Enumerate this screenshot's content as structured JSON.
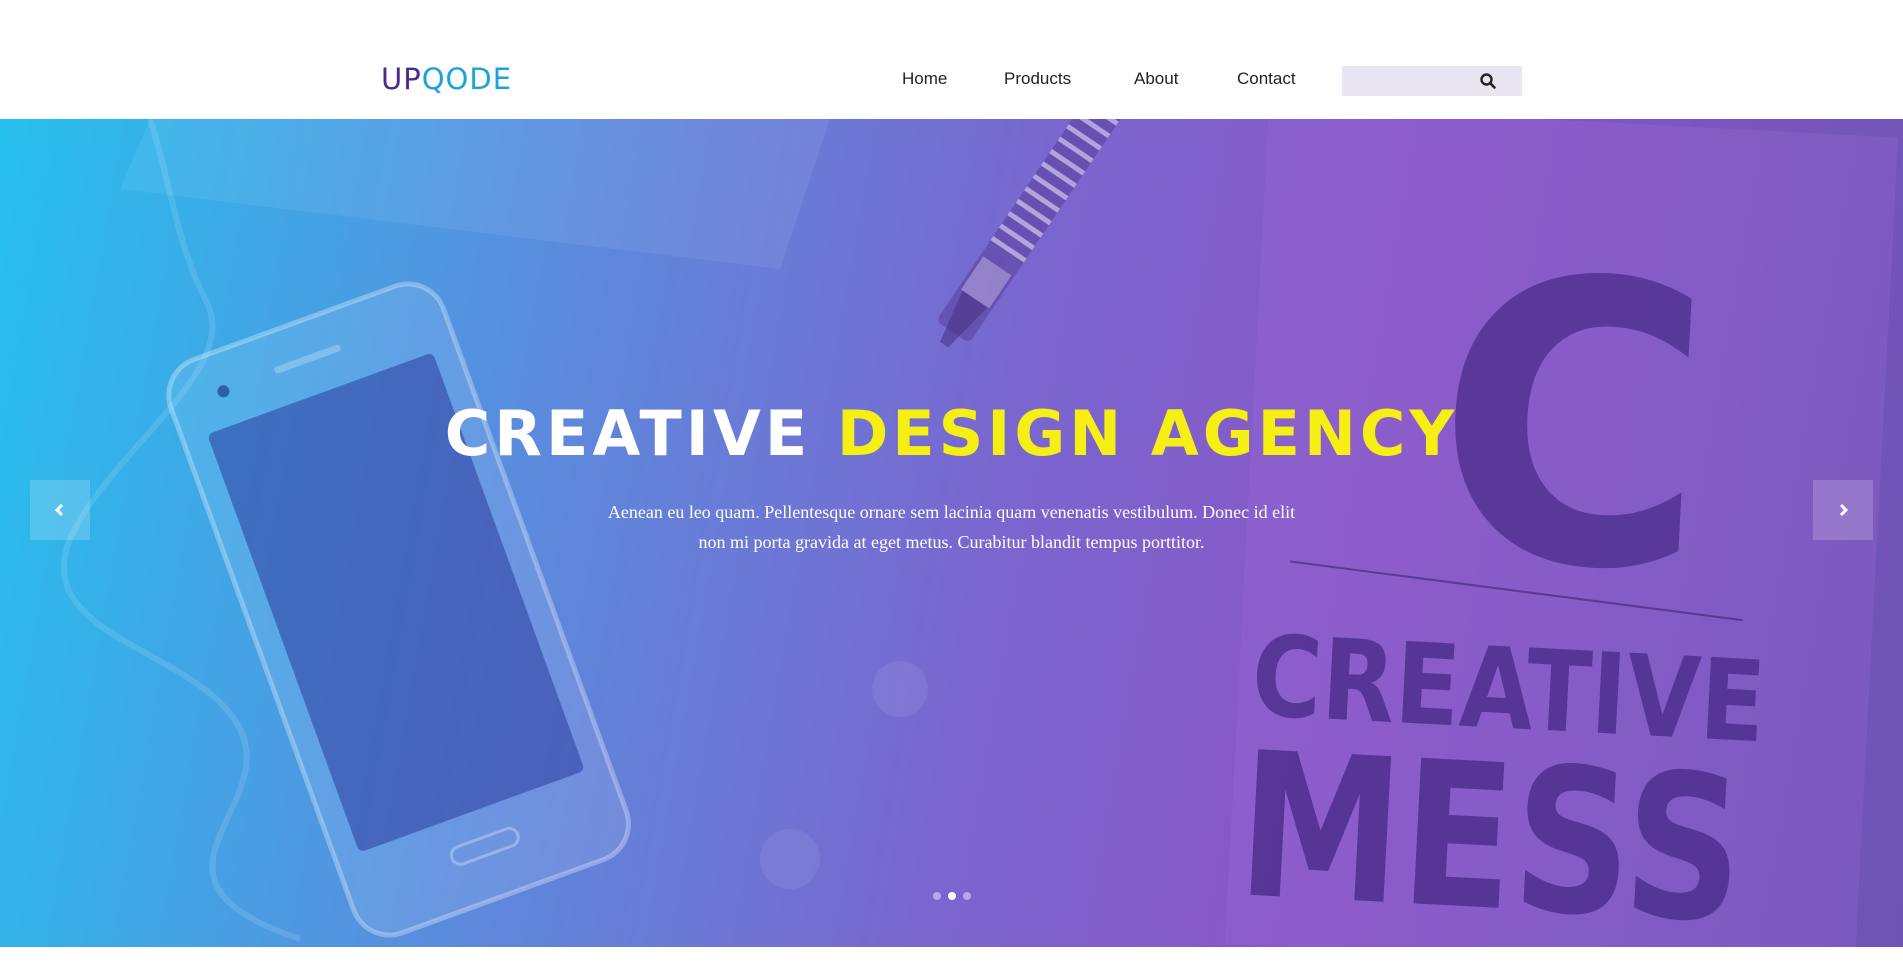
{
  "brand": {
    "logo_part1": "UP",
    "logo_part2": "QODE",
    "color_primary": "#4b2a8c",
    "color_secondary": "#1ea2dc"
  },
  "nav": {
    "items": [
      {
        "label": "Home"
      },
      {
        "label": "Products"
      },
      {
        "label": "About"
      },
      {
        "label": "Contact"
      }
    ]
  },
  "search": {
    "value": "",
    "placeholder": "",
    "icon": "search-icon"
  },
  "hero": {
    "title_white": "CREATIVE",
    "title_yellow": "DESIGN AGENCY",
    "text": "Aenean eu leo quam. Pellentesque ornare sem lacinia quam venenatis vestibulum. Donec id elit non mi porta gravida at eget metus. Curabitur blandit tempus porttitor.",
    "notebook_letter": "C",
    "notebook_line1": "CREATIVE",
    "notebook_line2": "MESS",
    "highlight_color": "#f6ef14",
    "prev_icon": "chevron-left-icon",
    "next_icon": "chevron-right-icon"
  },
  "slider": {
    "slide_count": 3,
    "active_index": 1
  }
}
